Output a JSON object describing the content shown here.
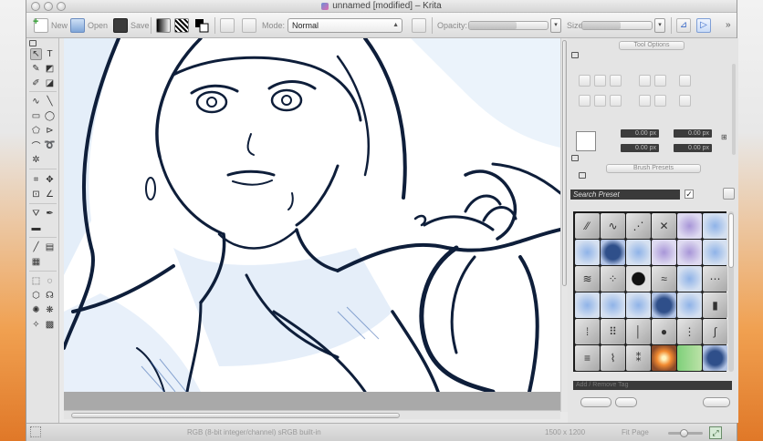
{
  "window": {
    "title": "unnamed [modified] – Krita"
  },
  "toolbar": {
    "new_label": "New",
    "open_label": "Open",
    "save_label": "Save",
    "mode_label": "Mode:",
    "mode_value": "Normal",
    "opacity_label": "Opacity:",
    "opacity_value": 0.6,
    "size_label": "Size:",
    "size_value": 0.55,
    "overflow": "»"
  },
  "dock": {
    "panel_tab_1": "Tool Options",
    "panel_tab_2": "Brush Presets",
    "px_fields": [
      "0.00 px",
      "0.00 px",
      "0.00 px",
      "0.00 px"
    ],
    "search_placeholder": "Search Preset",
    "tag_placeholder": "Add / Remove Tag"
  },
  "statusbar": {
    "color_info": "RGB (8-bit integer/channel)  sRGB built-in",
    "dimensions": "1500 x 1200",
    "zoom": "Fit Page",
    "zoom_value": 0.45
  },
  "colors": {
    "ink": "#0e1e3a",
    "shade": "#2a5aa8",
    "accent_orange": "#e07828"
  },
  "icons": [
    "new-file-icon",
    "open-file-icon",
    "save-icon",
    "gradient-icon",
    "pattern-icon",
    "color-swap-icon",
    "brush-editor-icon",
    "preset-history-icon",
    "eraser-icon",
    "mirror-horizontal-icon",
    "mirror-vertical-icon"
  ]
}
